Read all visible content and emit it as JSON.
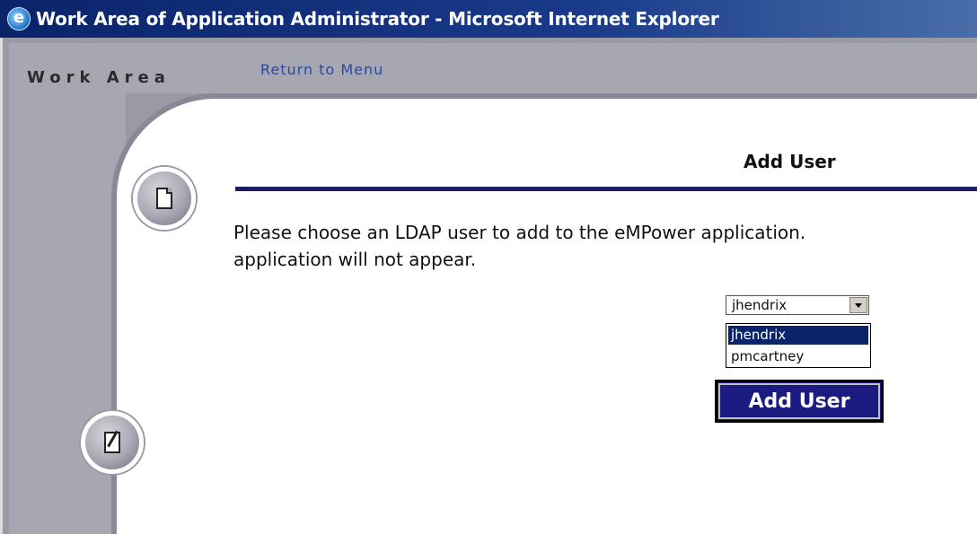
{
  "window": {
    "title": "Work Area of Application Administrator - Microsoft Internet Explorer"
  },
  "nav": {
    "work_area": "Work Area",
    "return_link": "Return to Menu"
  },
  "page": {
    "heading": "Add User",
    "instruction_line1": "Please choose an LDAP user to add to the eMPower application.",
    "instruction_line2": "application will not appear."
  },
  "user_select": {
    "selected": "jhendrix",
    "options": [
      "jhendrix",
      "pmcartney"
    ]
  },
  "buttons": {
    "add_user": "Add User"
  },
  "icons": {
    "browser": "ie-icon",
    "document": "document-icon",
    "edit": "edit-document-icon"
  },
  "colors": {
    "titlebar": "#0a246a",
    "rule": "#1a1f5e",
    "button": "#1a1a80",
    "link": "#2a4aa0"
  }
}
